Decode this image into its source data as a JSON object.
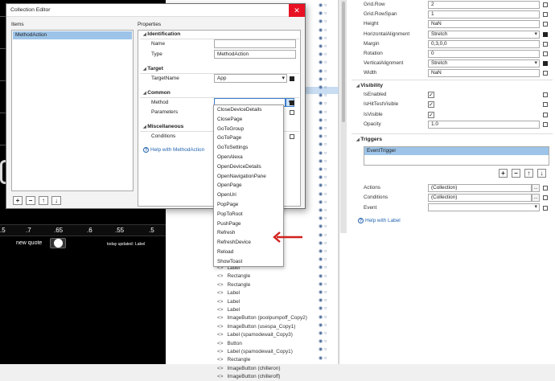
{
  "designer": {
    "numbers": [
      ".5",
      ".7",
      ".65",
      ".6",
      ".55",
      ".5"
    ],
    "quote_label": "new quote",
    "updated_label": "today updated:",
    "updated_value": "Label"
  },
  "tree": {
    "nodes": [
      "Label",
      "Rectangle",
      "Rectangle",
      "Label",
      "Label",
      "Label",
      "ImageButton (poolpumpoff_Copy2)",
      "ImageButton (usespa_Copy1)",
      "Label (spamodewait_Copy3)",
      "Button",
      "Label (spamodewait_Copy1)",
      "Rectangle",
      "ImageButton (chilleron)",
      "ImageButton (chilleroff)"
    ],
    "node_prefix": "<>"
  },
  "properties_panel": {
    "layout_rows": [
      {
        "label": "Grid.Row",
        "value": "2",
        "type": "text"
      },
      {
        "label": "Grid.RowSpan",
        "value": "1",
        "type": "text"
      },
      {
        "label": "Height",
        "value": "NaN",
        "type": "text"
      },
      {
        "label": "HorizontalAlignment",
        "value": "Stretch",
        "type": "select"
      },
      {
        "label": "Margin",
        "value": "0,3,0,0",
        "type": "text"
      },
      {
        "label": "Rotation",
        "value": "0",
        "type": "text"
      },
      {
        "label": "VerticalAlignment",
        "value": "Stretch",
        "type": "select"
      },
      {
        "label": "Width",
        "value": "NaN",
        "type": "text"
      }
    ],
    "visibility_title": "Visibility",
    "visibility_rows": [
      {
        "label": "IsEnabled",
        "checked": true
      },
      {
        "label": "IsHitTestVisible",
        "checked": true
      },
      {
        "label": "IsVisible",
        "checked": true
      }
    ],
    "opacity_label": "Opacity",
    "opacity_value": "1.0",
    "triggers_title": "Triggers",
    "trigger_selected": "EventTrigger",
    "trigger_buttons": [
      "+",
      "−",
      "↑",
      "↓"
    ],
    "actions_label": "Actions",
    "actions_value": "(Collection)",
    "conditions_label": "Conditions",
    "conditions_value": "(Collection)",
    "event_label": "Event",
    "event_value": "",
    "help_text": "Help with Label"
  },
  "dialog": {
    "title": "Collection Editor",
    "close_glyph": "✕",
    "items_label": "Items",
    "items": [
      "MethodAction"
    ],
    "item_buttons": [
      "+",
      "−",
      "↑",
      "↓"
    ],
    "properties_label": "Properties",
    "sections": {
      "identification": "Identification",
      "target": "Target",
      "common": "Common",
      "misc": "Miscellaneous"
    },
    "name_label": "Name",
    "name_value": "",
    "type_label": "Type",
    "type_value": "MethodAction",
    "target_label": "TargetName",
    "target_value": "App",
    "method_label": "Method",
    "method_value": "",
    "parameters_label": "Parameters",
    "conditions_label": "Conditions",
    "help_text": "Help with MethodAction"
  },
  "method_options": [
    "CloseDeviceDetails",
    "ClosePage",
    "GoToGroup",
    "GoToPage",
    "GoToSettings",
    "OpenAlexa",
    "OpenDeviceDetails",
    "OpenNavigationPane",
    "OpenPage",
    "OpenUri",
    "PopPage",
    "PopToRoot",
    "PushPage",
    "Refresh",
    "RefreshDevice",
    "Reload",
    "ShowToast"
  ],
  "colors": {
    "selection": "#9dc4e8",
    "link": "#2465b0",
    "close": "#e81123",
    "annotation_arrow": "#d0211c"
  }
}
